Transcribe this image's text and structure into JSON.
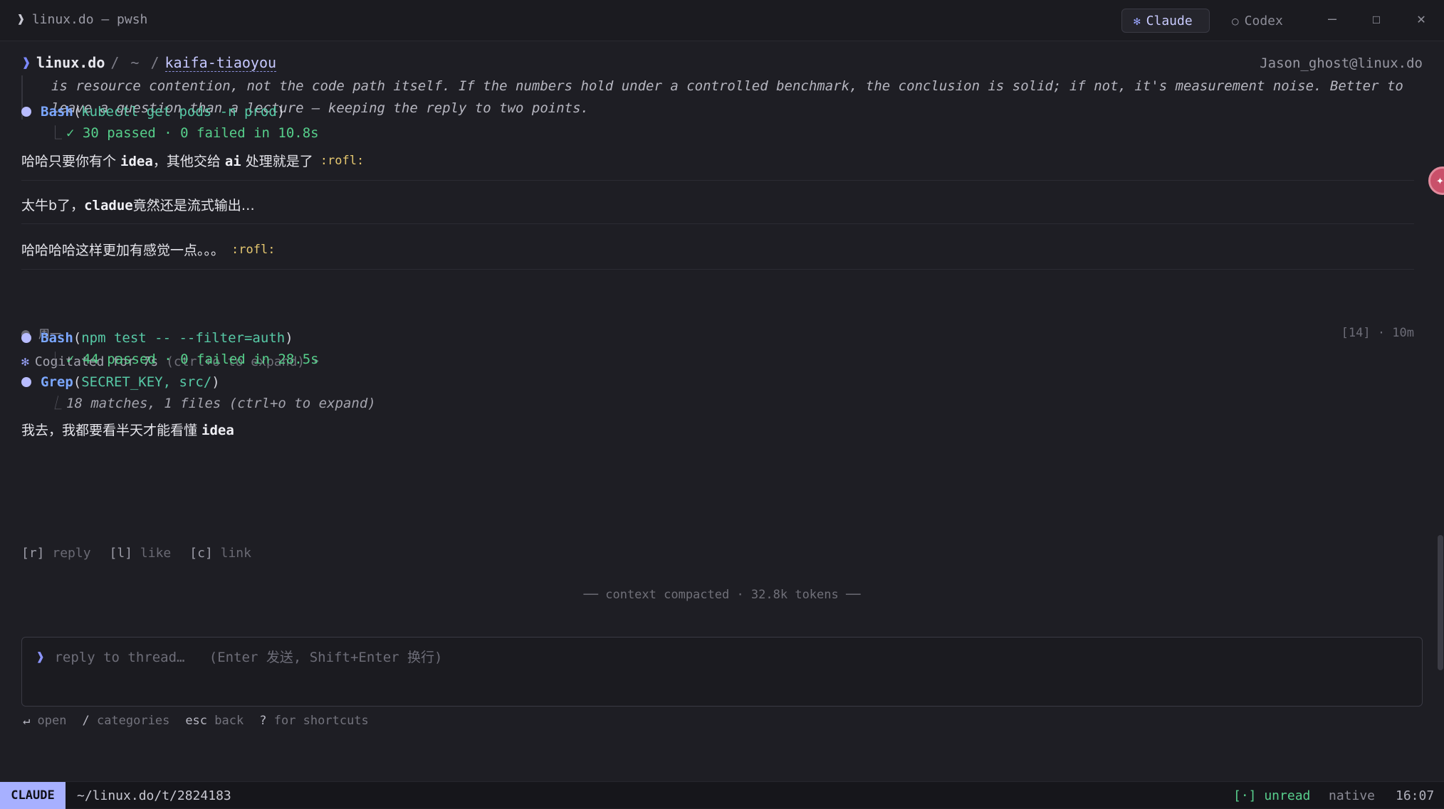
{
  "window": {
    "title": "linux.do — pwsh",
    "caret": "❱",
    "tabs": [
      {
        "label": "Claude",
        "icon": "✻",
        "active": true
      },
      {
        "label": "Codex",
        "icon": "○",
        "active": false
      }
    ],
    "controls": {
      "minimize": "—",
      "maximize": "☐",
      "close": "✕"
    }
  },
  "breadcrumb": {
    "caret": "❱",
    "site": "linux.do",
    "sep1": "/",
    "home": "~",
    "sep2": "/",
    "category": "kaifa-tiaoyou"
  },
  "user_handle": "Jason_ghost@linux.do",
  "quote": {
    "line1": "is resource contention, not the code path itself. If the numbers hold under a controlled benchmark, the conclusion is solid; if not, it's measurement noise. Better to",
    "line2": "leave a question than a lecture — keeping the reply to two points."
  },
  "tool_calls": [
    {
      "name": "Bash",
      "args": "kubectl get pods -n prod",
      "result": "✓ 30 passed · 0 failed in 10.8s"
    },
    {
      "name": "Bash",
      "args": "npm test -- --filter=auth",
      "result": "✓ 44 passed · 0 failed in 28.5s"
    },
    {
      "name": "Grep",
      "args": "SECRET_KEY, src/",
      "result": "18 matches, 1 files (ctrl+o to expand)"
    }
  ],
  "elbow": "⎿",
  "messages": [
    {
      "pre": "哈哈只要你有个 ",
      "mono1": "idea",
      "mid": "，其他交给 ",
      "mono2": "ai",
      "post": " 处理就是了",
      "emoji": ":rofl:"
    },
    {
      "pre": "太牛b了，",
      "mono1": "cladue",
      "post": "竟然还是流式输出…"
    },
    {
      "text": "哈哈哈哈这样更加有感觉一点。。。",
      "emoji": ":rofl:"
    },
    {
      "pre": "我去，我都要看半天才能看懂 ",
      "mono1": "idea"
    }
  ],
  "day_label": "周一",
  "post_meta": "[14] · 10m",
  "cogitated": {
    "star": "✻",
    "text": "Cogitated for 7s",
    "hint": "(ctrl+o to expand)",
    "arrow": "‣"
  },
  "actions": [
    {
      "key": "[r]",
      "label": "reply"
    },
    {
      "key": "[l]",
      "label": "like"
    },
    {
      "key": "[c]",
      "label": "link"
    }
  ],
  "compacted": "── context compacted · 32.8k tokens ──",
  "reply_box": {
    "caret": "❱",
    "placeholder": "reply to thread…   (Enter 发送, Shift+Enter 换行)"
  },
  "shortcuts": [
    {
      "key": "↵",
      "label": "open"
    },
    {
      "key": "/",
      "label": "categories"
    },
    {
      "key": "esc",
      "label": "back"
    },
    {
      "key": "?",
      "label": "for shortcuts"
    }
  ],
  "statusbar": {
    "mode": "CLAUDE",
    "path": "~/linux.do/t/2824183",
    "unread": "[·] unread",
    "native": "native",
    "time": "16:07"
  },
  "colors": {
    "accent": "#a7b0ff",
    "tool_name": "#7ba7ff",
    "tool_args": "#57c9a6",
    "success": "#56cf8b",
    "emoji_tag": "#e6c870",
    "notification_badge": "#c9506a"
  }
}
